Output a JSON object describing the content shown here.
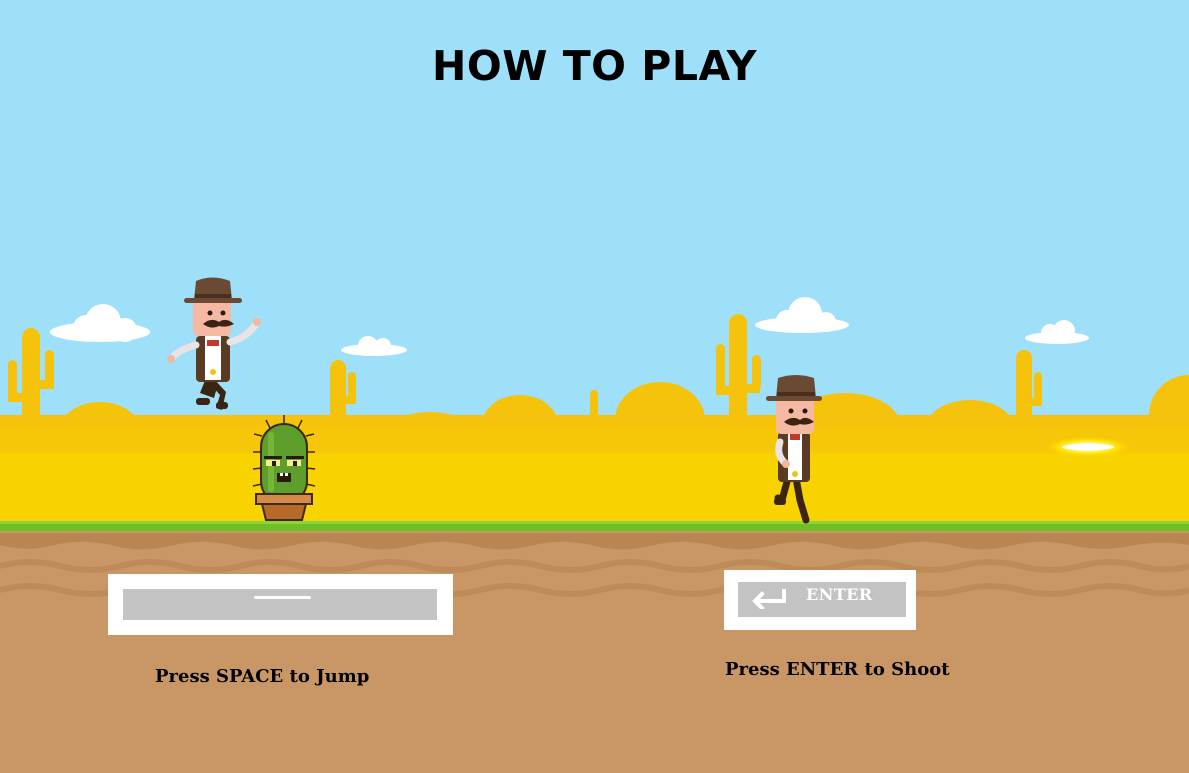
{
  "screen": {
    "title": "HOW TO PLAY"
  },
  "controls": {
    "jump": {
      "key_label": "",
      "instruction": "Press SPACE to Jump"
    },
    "shoot": {
      "key_label": "ENTER",
      "instruction": "Press ENTER to Shoot"
    }
  },
  "colors": {
    "sky": "#9ee0fa",
    "sand_back": "#f5c30c",
    "sand_front": "#f8d300",
    "grass": "#6fbf26",
    "dirt": "#c99766",
    "dirt_wave": "#bd8a58",
    "keycap_face": "#c3c3c3"
  },
  "icons": {
    "cowboy": "cowboy-icon",
    "cactus": "cactus-enemy-icon",
    "bullet": "bullet-glow-icon",
    "enter_arrow": "enter-arrow-icon"
  }
}
